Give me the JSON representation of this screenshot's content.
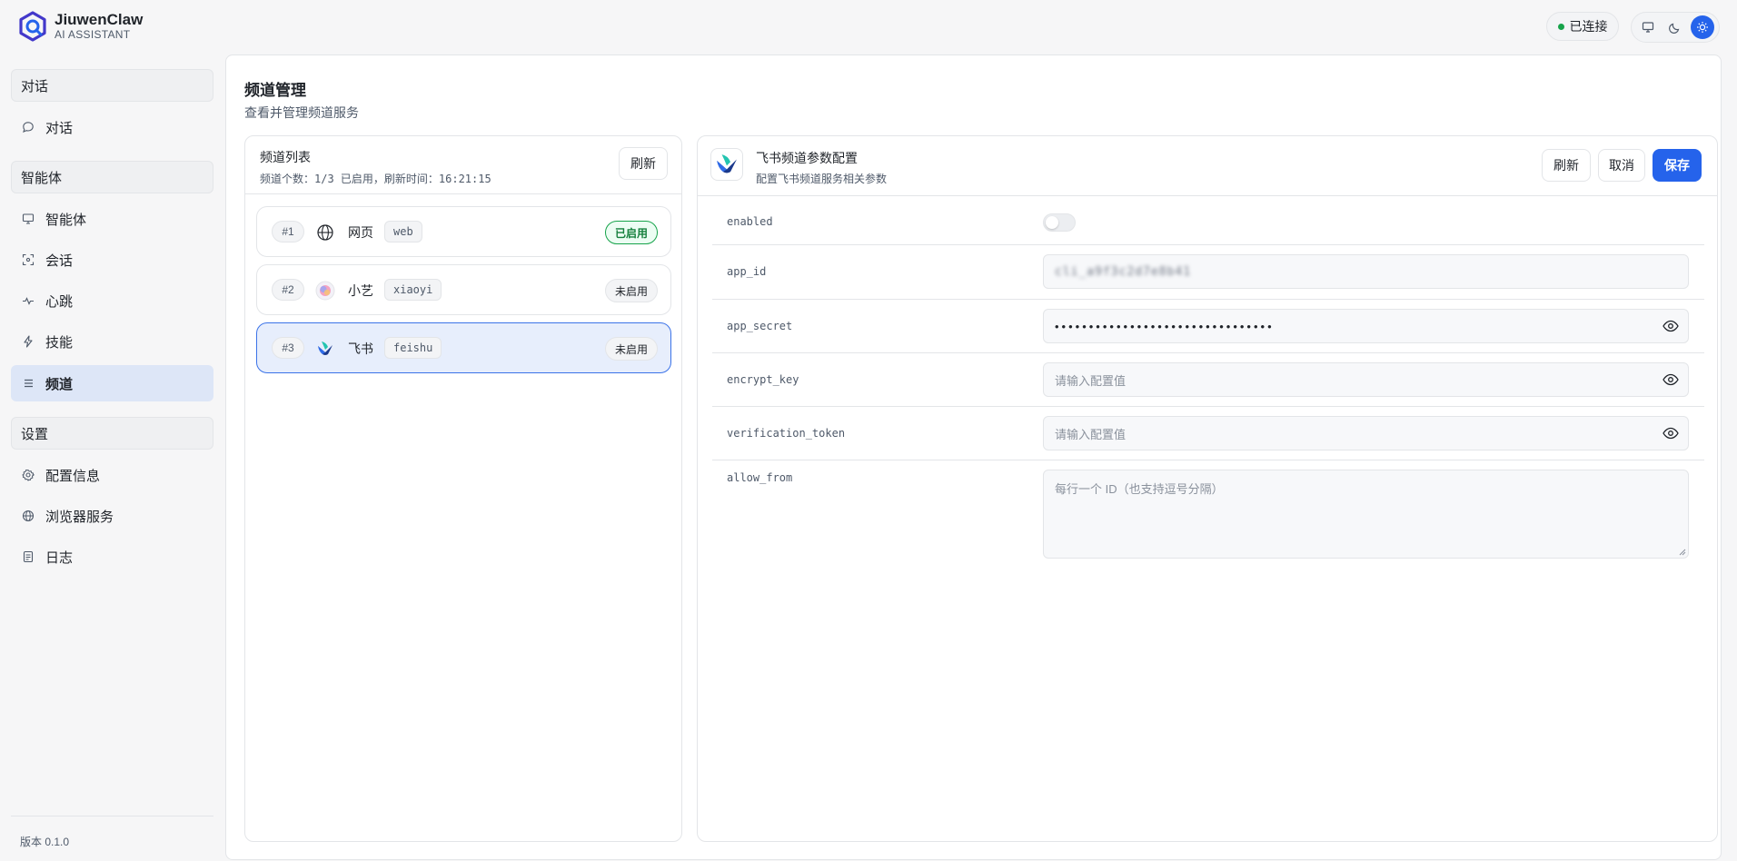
{
  "app": {
    "name": "JiuwenClaw",
    "subtitle": "AI ASSISTANT",
    "version": "版本 0.1.0"
  },
  "header": {
    "status": "已连接",
    "theme_modes": [
      "monitor-icon",
      "moon-icon",
      "sun-icon"
    ],
    "active_theme": "sun"
  },
  "sidebar": {
    "sections": [
      {
        "title": "对话",
        "items": [
          {
            "label": "对话",
            "icon": "chat-bubble-icon"
          }
        ]
      },
      {
        "title": "智能体",
        "items": [
          {
            "label": "智能体",
            "icon": "monitor-icon"
          },
          {
            "label": "会话",
            "icon": "scan-icon"
          },
          {
            "label": "心跳",
            "icon": "pulse-icon"
          },
          {
            "label": "技能",
            "icon": "bolt-icon"
          },
          {
            "label": "频道",
            "icon": "list-icon",
            "active": true
          }
        ]
      },
      {
        "title": "设置",
        "items": [
          {
            "label": "配置信息",
            "icon": "gear-icon"
          },
          {
            "label": "浏览器服务",
            "icon": "globe-icon"
          },
          {
            "label": "日志",
            "icon": "document-icon"
          }
        ]
      }
    ]
  },
  "page": {
    "title": "频道管理",
    "subtitle": "查看并管理频道服务"
  },
  "channel_list": {
    "title": "频道列表",
    "meta": "频道个数：1/3 已启用，刷新时间：16:21:15",
    "refresh_label": "刷新",
    "items": [
      {
        "index": "#1",
        "name": "网页",
        "code": "web",
        "status": "已启用",
        "enabled": true,
        "icon": "globe-icon"
      },
      {
        "index": "#2",
        "name": "小艺",
        "code": "xiaoyi",
        "status": "未启用",
        "enabled": false,
        "icon": "xiaoyi-icon"
      },
      {
        "index": "#3",
        "name": "飞书",
        "code": "feishu",
        "status": "未启用",
        "enabled": false,
        "icon": "feishu-icon",
        "selected": true
      }
    ]
  },
  "config": {
    "title": "飞书频道参数配置",
    "subtitle": "配置飞书频道服务相关参数",
    "buttons": {
      "refresh": "刷新",
      "cancel": "取消",
      "save": "保存"
    },
    "fields": {
      "enabled": {
        "label": "enabled",
        "value": false
      },
      "app_id": {
        "label": "app_id",
        "value": "cli_a9f3c2d7e8b41"
      },
      "app_secret": {
        "label": "app_secret",
        "value": "••••••••••••••••••••••••••••••••"
      },
      "encrypt_key": {
        "label": "encrypt_key",
        "placeholder": "请输入配置值"
      },
      "verification_token": {
        "label": "verification_token",
        "placeholder": "请输入配置值"
      },
      "allow_from": {
        "label": "allow_from",
        "placeholder": "每行一个 ID（也支持逗号分隔）"
      }
    }
  },
  "colors": {
    "accent": "#2563eb",
    "success": "#16a34a",
    "selected_bg": "#e7eefc"
  }
}
